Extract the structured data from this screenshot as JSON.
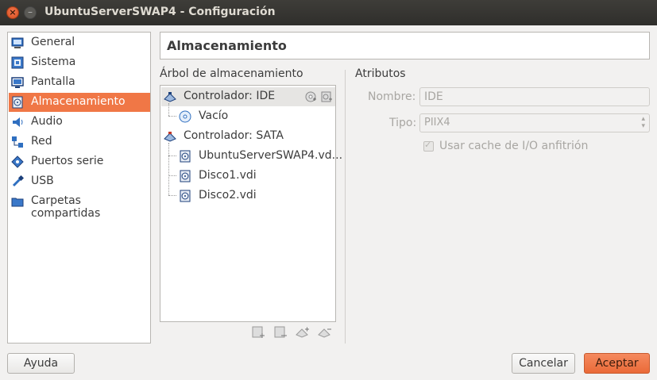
{
  "window": {
    "title": "UbuntuServerSWAP4 - Configuración"
  },
  "sidebar": {
    "items": [
      {
        "label": "General",
        "icon": "general-icon"
      },
      {
        "label": "Sistema",
        "icon": "system-icon"
      },
      {
        "label": "Pantalla",
        "icon": "display-icon"
      },
      {
        "label": "Almacenamiento",
        "icon": "storage-icon",
        "selected": true
      },
      {
        "label": "Audio",
        "icon": "audio-icon"
      },
      {
        "label": "Red",
        "icon": "network-icon"
      },
      {
        "label": "Puertos serie",
        "icon": "serial-port-icon"
      },
      {
        "label": "USB",
        "icon": "usb-icon"
      },
      {
        "label": "Carpetas compartidas",
        "icon": "shared-folder-icon"
      }
    ]
  },
  "page": {
    "title": "Almacenamiento"
  },
  "tree": {
    "title": "Árbol de almacenamiento",
    "ide_controller": "Controlador: IDE",
    "ide_children": [
      "Vacío"
    ],
    "sata_controller": "Controlador: SATA",
    "sata_children": [
      "UbuntuServerSWAP4.vd...",
      "Disco1.vdi",
      "Disco2.vdi"
    ]
  },
  "attributes": {
    "title": "Atributos",
    "name_label": "Nombre:",
    "name_value": "IDE",
    "type_label": "Tipo:",
    "type_value": "PIIX4",
    "cache_label": "Usar cache de I/O anfitrión",
    "cache_checked": true
  },
  "buttons": {
    "help": "Ayuda",
    "cancel": "Cancelar",
    "accept": "Aceptar"
  },
  "colors": {
    "accent": "#f07746",
    "titlebar": "#3c3b37"
  }
}
